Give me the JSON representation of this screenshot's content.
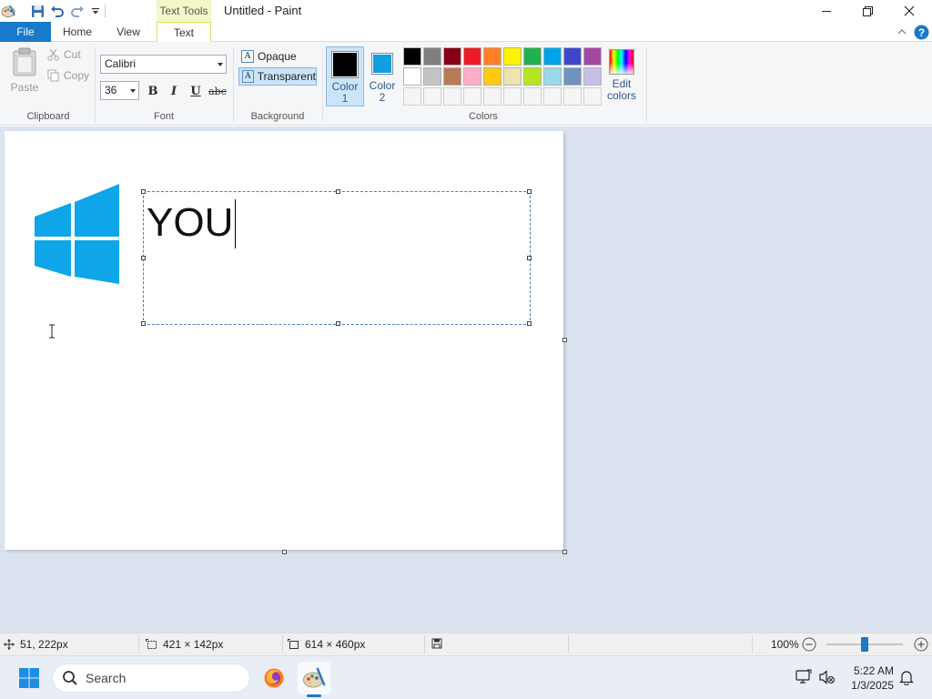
{
  "window": {
    "contextual_tab": "Text Tools",
    "title": "Untitled - Paint"
  },
  "tabs": {
    "file": "File",
    "home": "Home",
    "view": "View",
    "text": "Text"
  },
  "ribbon": {
    "clipboard": {
      "paste": "Paste",
      "cut": "Cut",
      "copy": "Copy",
      "label": "Clipboard"
    },
    "font": {
      "family": "Calibri",
      "size": "36",
      "bold": "B",
      "italic": "I",
      "underline": "U",
      "strikethrough": "abc",
      "label": "Font"
    },
    "background": {
      "opaque": "Opaque",
      "transparent": "Transparent",
      "selected": "Transparent",
      "label": "Background"
    },
    "colors": {
      "color1_line1": "Color",
      "color1_line2": "1",
      "color2_line1": "Color",
      "color2_line2": "2",
      "color1_value": "#000000",
      "color2_value": "#0f9ee0",
      "edit_line1": "Edit",
      "edit_line2": "colors",
      "label": "Colors",
      "palette_row1": [
        "#000000",
        "#7f7f7f",
        "#880015",
        "#ed1c24",
        "#ff7f27",
        "#fff200",
        "#22b14c",
        "#00a2e8",
        "#3f48cc",
        "#a349a4"
      ],
      "palette_row2": [
        "#ffffff",
        "#c3c3c3",
        "#b97a57",
        "#ffaec9",
        "#ffc90e",
        "#efe4b0",
        "#b5e61d",
        "#99d9ea",
        "#7092be",
        "#c8bfe7"
      ],
      "palette_row3": [
        "#f5f5f5",
        "#f5f5f5",
        "#f5f5f5",
        "#f5f5f5",
        "#f5f5f5",
        "#f5f5f5",
        "#f5f5f5",
        "#f5f5f5",
        "#f5f5f5",
        "#f5f5f5"
      ]
    }
  },
  "canvas": {
    "typed_text": "YOU",
    "logo_color": "#0ea5e9"
  },
  "status": {
    "cursor_pos": "51, 222px",
    "selection_size": "421 × 142px",
    "image_size": "614 × 460px",
    "zoom": "100%"
  },
  "taskbar": {
    "search_placeholder": "Search",
    "time": "5:22 AM",
    "date": "1/3/2025"
  }
}
